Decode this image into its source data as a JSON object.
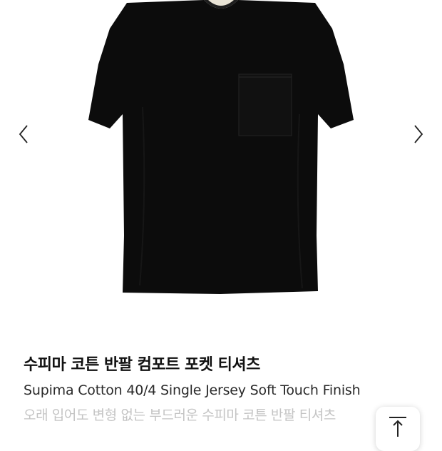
{
  "gallery": {
    "image_subject": "black short-sleeve pocket t-shirt",
    "prev_icon": "chevron-left-icon",
    "next_icon": "chevron-right-icon"
  },
  "product": {
    "title": "수피마 코튼 반팔 컴포트 포켓 티셔츠",
    "subtitle": "Supima Cotton 40/4 Single Jersey Soft Touch Finish",
    "description": "오래 입어도 변형 없는 부드러운 수피마 코튼 반팔 티셔츠"
  },
  "scroll_top": {
    "icon": "arrow-up-to-top-icon"
  },
  "colors": {
    "shirt": "#0c0c0c",
    "title": "#111111",
    "subtitle": "#2a2a2a",
    "description": "#c4c4c4"
  }
}
